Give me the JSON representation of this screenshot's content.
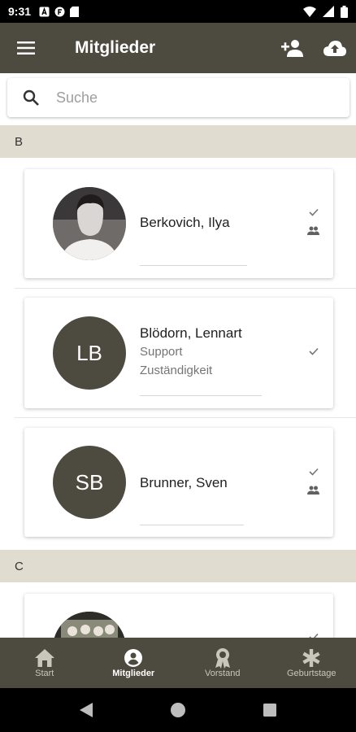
{
  "status_bar": {
    "time": "9:31"
  },
  "app_bar": {
    "title": "Mitglieder"
  },
  "search": {
    "placeholder": "Suche",
    "value": ""
  },
  "sections": [
    {
      "letter": "B"
    },
    {
      "letter": "C"
    }
  ],
  "members": [
    {
      "name": "Berkovich, Ilya",
      "initials": "",
      "role": "",
      "role2": "",
      "has_photo": true
    },
    {
      "name": "Blödorn, Lennart",
      "initials": "LB",
      "role": "Support",
      "role2": "Zuständigkeit",
      "has_photo": false
    },
    {
      "name": "Brunner, Sven",
      "initials": "SB",
      "role": "",
      "role2": "",
      "has_photo": false
    }
  ],
  "bottom_nav": [
    {
      "label": "Start",
      "icon": "home-icon",
      "active": false
    },
    {
      "label": "Mitglieder",
      "icon": "account-circle-icon",
      "active": true
    },
    {
      "label": "Vorstand",
      "icon": "award-icon",
      "active": false
    },
    {
      "label": "Geburtstage",
      "icon": "asterisk-icon",
      "active": false
    }
  ],
  "colors": {
    "primary": "#4d4a3f",
    "section_bg": "#e0dccf"
  }
}
